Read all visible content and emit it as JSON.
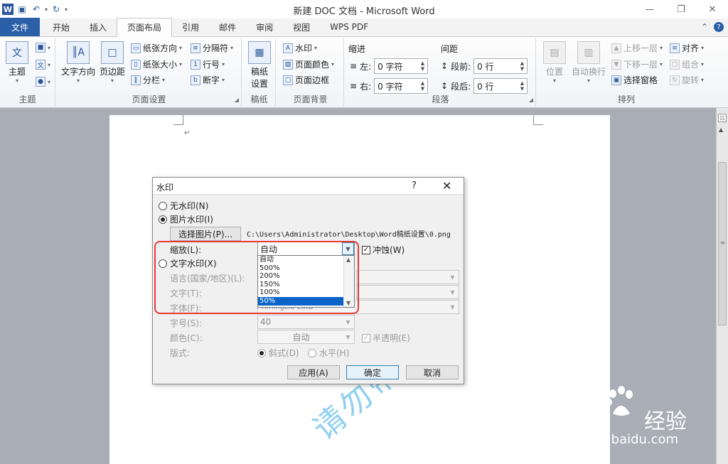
{
  "window": {
    "title": "新建 DOC 文档 - Microsoft Word",
    "app_icon": "W"
  },
  "tabs": [
    {
      "label": "文件"
    },
    {
      "label": "开始"
    },
    {
      "label": "插入"
    },
    {
      "label": "页面布局"
    },
    {
      "label": "引用"
    },
    {
      "label": "邮件"
    },
    {
      "label": "审阅"
    },
    {
      "label": "视图"
    },
    {
      "label": "WPS PDF"
    }
  ],
  "ribbon": {
    "theme": {
      "label": "主题",
      "button": "主题"
    },
    "page_setup": {
      "label": "页面设置",
      "text_direction": "文字方向",
      "margins": "页边距",
      "orientation": "纸张方向",
      "size": "纸张大小",
      "columns": "分栏",
      "breaks": "分隔符",
      "line_numbers": "行号",
      "hyphenation": "断字"
    },
    "manuscript": {
      "label": "稿纸",
      "button_line1": "稿纸",
      "button_line2": "设置"
    },
    "page_background": {
      "label": "页面背景",
      "watermark": "水印",
      "page_color": "页面颜色",
      "page_borders": "页面边框"
    },
    "paragraph": {
      "label": "段落",
      "indent_title": "缩进",
      "spacing_title": "间距",
      "left_label": "左:",
      "left_value": "0 字符",
      "right_label": "右:",
      "right_value": "0 字符",
      "before_label": "段前:",
      "before_value": "0 行",
      "after_label": "段后:",
      "after_value": "0 行"
    },
    "arrange": {
      "label": "排列",
      "position": "位置",
      "wrap_text": "自动换行",
      "bring_forward": "上移一层",
      "send_backward": "下移一层",
      "selection_pane": "选择窗格",
      "align": "对齐",
      "group": "组合",
      "rotate": "旋转"
    }
  },
  "document": {
    "watermark_preview": "请勿带出"
  },
  "dialog": {
    "title": "水印",
    "help": "?",
    "no_watermark": "无水印(N)",
    "picture_watermark": "图片水印(I)",
    "select_picture": "选择图片(P)...",
    "picture_path": "C:\\Users\\Administrator\\Desktop\\Word稿纸设置\\0.png",
    "scale_label": "缩放(L):",
    "scale_value": "自动",
    "scale_options": [
      "自动",
      "500%",
      "200%",
      "150%",
      "100%",
      "50%"
    ],
    "washout": "冲蚀(W)",
    "text_watermark": "文字水印(X)",
    "language_label": "语言(国家/地区)(L):",
    "text_label": "文字(T):",
    "font_label": "字体(F):",
    "font_value": "TimingLiu ExtB",
    "size_label": "字号(S):",
    "size_value": "40",
    "color_label": "颜色(C):",
    "color_value": "自动",
    "semitransparent": "半透明(E)",
    "layout_label": "版式:",
    "diagonal": "斜式(D)",
    "horizontal": "水平(H)",
    "apply": "应用(A)",
    "ok": "确定",
    "cancel": "取消"
  },
  "baidu": {
    "brand": "Bai",
    "brand2": "经验",
    "url": "jingyan.baidu.com"
  },
  "colors": {
    "file_tab": "#2b5fa8",
    "selection": "#0a64c8",
    "highlight": "#e53935"
  }
}
